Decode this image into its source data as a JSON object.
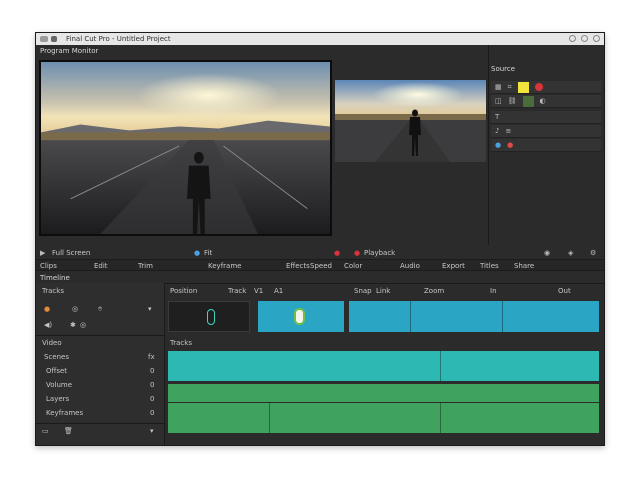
{
  "window": {
    "title": "Final Cut Pro - Untitled Project"
  },
  "viewer": {
    "main_label": "Program Monitor",
    "source_label": "Source"
  },
  "transport": {
    "left_label": "Full Screen",
    "center_label": "Fit",
    "right_label": "Playback"
  },
  "toolbar": {
    "items": [
      "Clips",
      "Edit",
      "Trim",
      "Keyframe",
      "Effects",
      "Speed",
      "Color",
      "Audio",
      "Export",
      "Titles",
      "Share"
    ]
  },
  "timeline": {
    "panel_label": "Timeline",
    "header_left": "Tracks",
    "header_items": [
      "Position",
      "Track",
      "V1",
      "A1",
      "Snap",
      "Link",
      "Zoom",
      "In",
      "Out"
    ],
    "labels_row": "Tracks"
  },
  "left_panel": {
    "video_label": "Video",
    "items": [
      "Scenes",
      "Offset",
      "Volume",
      "Layers",
      "Keyframes"
    ],
    "values": [
      "fx",
      "0",
      "0",
      "0",
      "0"
    ]
  },
  "colors": {
    "window_bg": "#2b2b2b",
    "video_clip": "#2aa6c4",
    "audio_track_teal": "#2eb8b3",
    "audio_track_green": "#3fa35f",
    "accent_yellow": "#f0e33a",
    "accent_red": "#d9333b"
  }
}
